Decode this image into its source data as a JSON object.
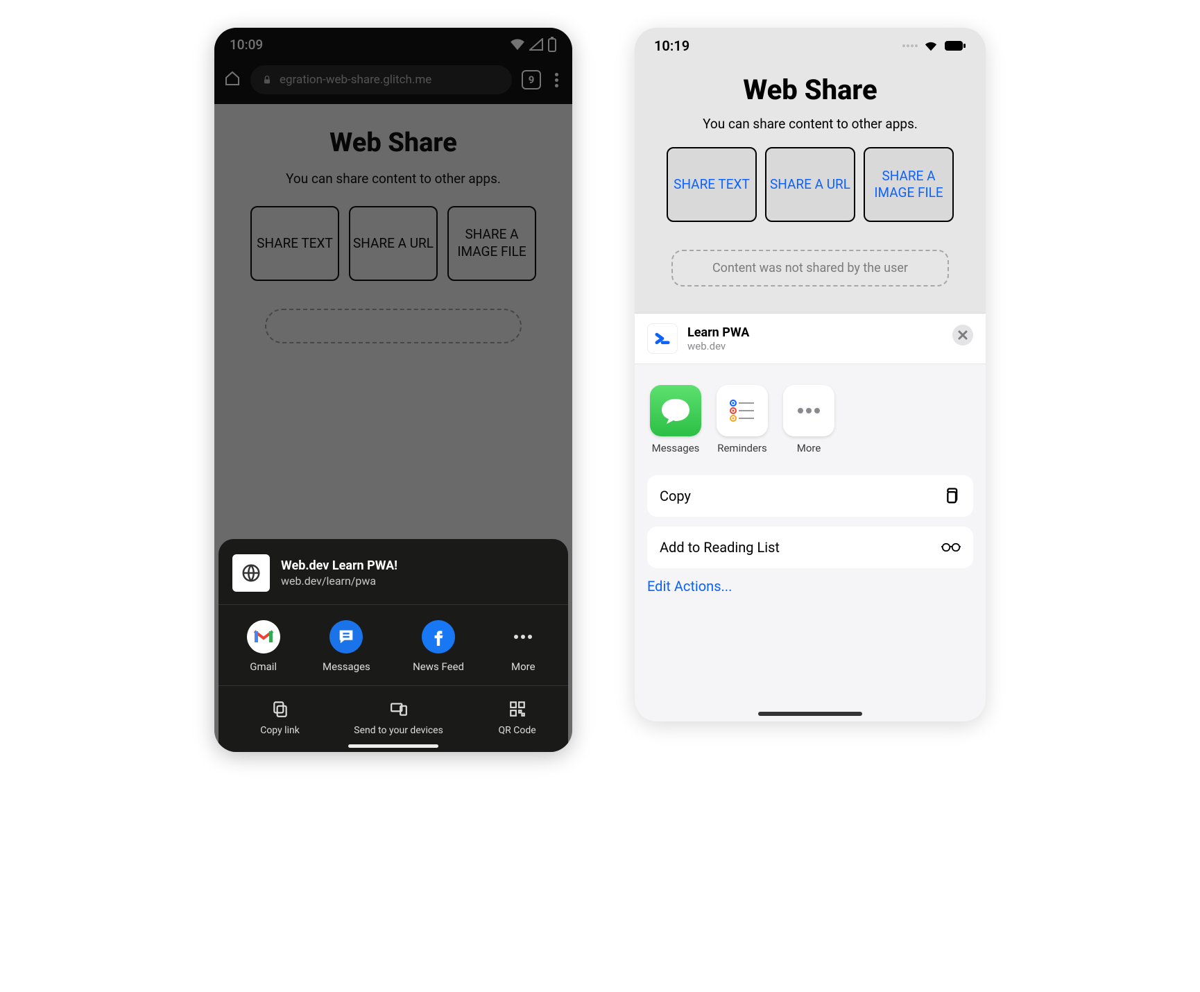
{
  "android": {
    "status": {
      "time": "10:09"
    },
    "urlbar": {
      "url_text": "egration-web-share.glitch.me",
      "tab_count": "9"
    },
    "page": {
      "title": "Web Share",
      "subtitle": "You can share content to other apps.",
      "buttons": [
        "SHARE TEXT",
        "SHARE A URL",
        "SHARE A IMAGE FILE"
      ]
    },
    "sheet": {
      "title": "Web.dev Learn PWA!",
      "subtitle": "web.dev/learn/pwa",
      "apps": [
        "Gmail",
        "Messages",
        "News Feed",
        "More"
      ],
      "actions": [
        "Copy link",
        "Send to your devices",
        "QR Code"
      ]
    }
  },
  "ios": {
    "status": {
      "time": "10:19"
    },
    "page": {
      "title": "Web Share",
      "subtitle": "You can share content to other apps.",
      "buttons": [
        "SHARE TEXT",
        "SHARE A URL",
        "SHARE A IMAGE FILE"
      ],
      "status_message": "Content was not shared by the user"
    },
    "sheet": {
      "title": "Learn PWA",
      "subtitle": "web.dev",
      "apps": [
        "Messages",
        "Reminders",
        "More"
      ],
      "actions": [
        "Copy",
        "Add to Reading List"
      ],
      "edit_link": "Edit Actions..."
    }
  }
}
